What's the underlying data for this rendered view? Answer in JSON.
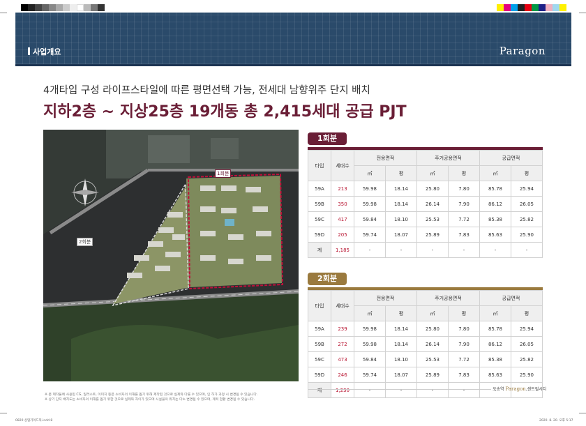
{
  "header": {
    "section_title": "사업개요",
    "brand": "Paragon"
  },
  "headline": {
    "line1": "4개타입 구성 라이프스타일에 따른 평면선택 가능, 전세대 남향위주 단지 배치",
    "line2": "지하2층 ~ 지상25층 19개동 총 2,415세대 공급 PJT"
  },
  "map": {
    "label_phase1": "1회분",
    "label_phase2": "2회분"
  },
  "colors": {
    "banner": "#2a4a6a",
    "phase1": "#6a1e36",
    "phase2": "#9a7a3e",
    "highlight_number": "#b7102d"
  },
  "columns": {
    "type": "타입",
    "units": "세대수",
    "exclusive": "전용면적",
    "residential_common": "주거공용면적",
    "supply": "공급면적",
    "sqm": "㎡",
    "pyeong": "평"
  },
  "phase1": {
    "label": "1회분",
    "rows": [
      {
        "type": "59A",
        "units": "213",
        "ex_sqm": "59.98",
        "ex_py": "18.14",
        "rc_sqm": "25.80",
        "rc_py": "7.80",
        "sp_sqm": "85.78",
        "sp_py": "25.94"
      },
      {
        "type": "59B",
        "units": "350",
        "ex_sqm": "59.98",
        "ex_py": "18.14",
        "rc_sqm": "26.14",
        "rc_py": "7.90",
        "sp_sqm": "86.12",
        "sp_py": "26.05"
      },
      {
        "type": "59C",
        "units": "417",
        "ex_sqm": "59.84",
        "ex_py": "18.10",
        "rc_sqm": "25.53",
        "rc_py": "7.72",
        "sp_sqm": "85.38",
        "sp_py": "25.82"
      },
      {
        "type": "59D",
        "units": "205",
        "ex_sqm": "59.74",
        "ex_py": "18.07",
        "rc_sqm": "25.89",
        "rc_py": "7.83",
        "sp_sqm": "85.63",
        "sp_py": "25.90"
      }
    ],
    "total": {
      "type": "계",
      "units": "1,185",
      "dash": "-"
    }
  },
  "phase2": {
    "label": "2회분",
    "rows": [
      {
        "type": "59A",
        "units": "239",
        "ex_sqm": "59.98",
        "ex_py": "18.14",
        "rc_sqm": "25.80",
        "rc_py": "7.80",
        "sp_sqm": "85.78",
        "sp_py": "25.94"
      },
      {
        "type": "59B",
        "units": "272",
        "ex_sqm": "59.98",
        "ex_py": "18.14",
        "rc_sqm": "26.14",
        "rc_py": "7.90",
        "sp_sqm": "86.12",
        "sp_py": "26.05"
      },
      {
        "type": "59C",
        "units": "473",
        "ex_sqm": "59.84",
        "ex_py": "18.10",
        "rc_sqm": "25.53",
        "rc_py": "7.72",
        "sp_sqm": "85.38",
        "sp_py": "25.82"
      },
      {
        "type": "59D",
        "units": "246",
        "ex_sqm": "59.74",
        "ex_py": "18.07",
        "rc_sqm": "25.89",
        "rc_py": "7.83",
        "sp_sqm": "85.63",
        "sp_py": "25.90"
      }
    ],
    "total": {
      "type": "계",
      "units": "1,230",
      "dash": "-"
    }
  },
  "footer": {
    "note1": "※ 본 제작물에 사용된 CG, 일러스트, 이미지 등은 소비자의 이해를 돕기 위해 제작된 것으로 실제와 다를 수 있으며, 인 허가 과정 시 변경될 수 있습니다.",
    "note2": "※ 상기 단지 배치도는 소비자의 이해를 돕기 위한 것으로 실제와 차이가 있으며 시설물의 위치는 다소 변경될 수 있으며, 계획 현황 변경될 수 있습니다.",
    "brand_prefix": "오송역",
    "brand_name": "Paragon",
    "brand_suffix": "센트럴시티"
  },
  "slug": {
    "left": "0820 상업기이드북.indd   8",
    "right": "2020. 8. 20.   오후 5:17"
  }
}
